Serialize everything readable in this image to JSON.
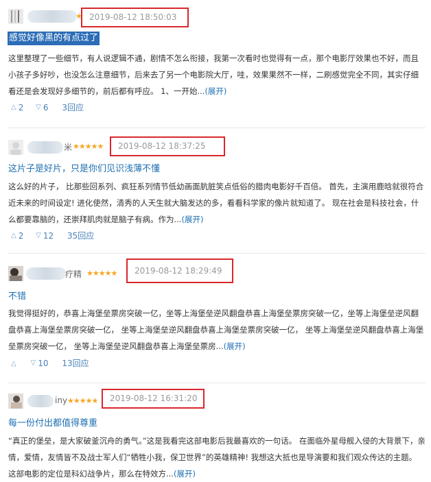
{
  "reviews": [
    {
      "name": "",
      "stars": "★",
      "time": "2019-08-12 18:50:03",
      "title": "感觉好像黑的有点过了",
      "body": "这里整理了一些细节，有人说逻辑不通，剧情不怎么衔接，我第一次看时也觉得有一点，那个电影厅效果也不好，而且小孩子多好吵，也没怎么注意细节，后来去了另一个电影院大厅，哇，效果果然不一样，二刷感觉完全不同，其实仔细看还是会发现好多细节的，前后都有呼应。 1、一开始...",
      "expand": "(展开)",
      "up": "2",
      "down": "6",
      "replies": "3回应"
    },
    {
      "name": "米",
      "stars": "★★★★★",
      "time": "2019-08-12 18:37:25",
      "title": "这片子是好片，只是你们见识浅薄不懂",
      "body": "这么好的片子， 比那些回系列、疯狂系列情节低幼画面肮脏笑点低俗的腊肉电影好千百倍。 首先，主演用鹿晗就很符合近未来的时间设定! 进化使然，清秀的人天生就大脑发达的多，看看科学家的像片就知道了。 现在社会是科技社会，什么都要靠脑的，还崇拜肌肉就是脑子有病。作为...",
      "expand": "(展开)",
      "up": "2",
      "down": "12",
      "replies": "35回应"
    },
    {
      "name": "疗精",
      "stars": "★★★★★",
      "time": "2019-08-12 18:29:49",
      "title": "不错",
      "body": "我觉得挺好的，恭喜上海堡垒票房突破一亿，坐等上海堡垒逆风翻盘恭喜上海堡垒票房突破一亿，坐等上海堡垒逆风翻盘恭喜上海堡垒票房突破一亿， 坐等上海堡垒逆风翻盘恭喜上海堡垒票房突破一亿， 坐等上海堡垒逆风翻盘恭喜上海堡垒票房突破一亿， 坐等上海堡垒逆风翻盘恭喜上海堡垒票房...",
      "expand": "(展开)",
      "up": "",
      "down": "10",
      "replies": "13回应"
    },
    {
      "name": "iny",
      "stars": "★★★★★",
      "time": "2019-08-12 16:31:20",
      "title": "每一份付出都值得尊重",
      "body": "“真正的堡垒，是大家破釜沉舟的勇气。”这是我看完这部电影后我最喜欢的一句话。 在面临外星母舰入侵的大背景下，亲情，爱情，友情皆不及战士军人们“牺牲小我，保卫世界”的英雄精神! 我想这大抵也是导演要和我们观众传达的主题。 这部电影的定位是科幻战争片，那么在特效方...",
      "expand": "(展开)"
    }
  ],
  "colors": {
    "highlight_box": "#d9262b",
    "link": "#1f6fb2",
    "star": "#f5a623"
  }
}
